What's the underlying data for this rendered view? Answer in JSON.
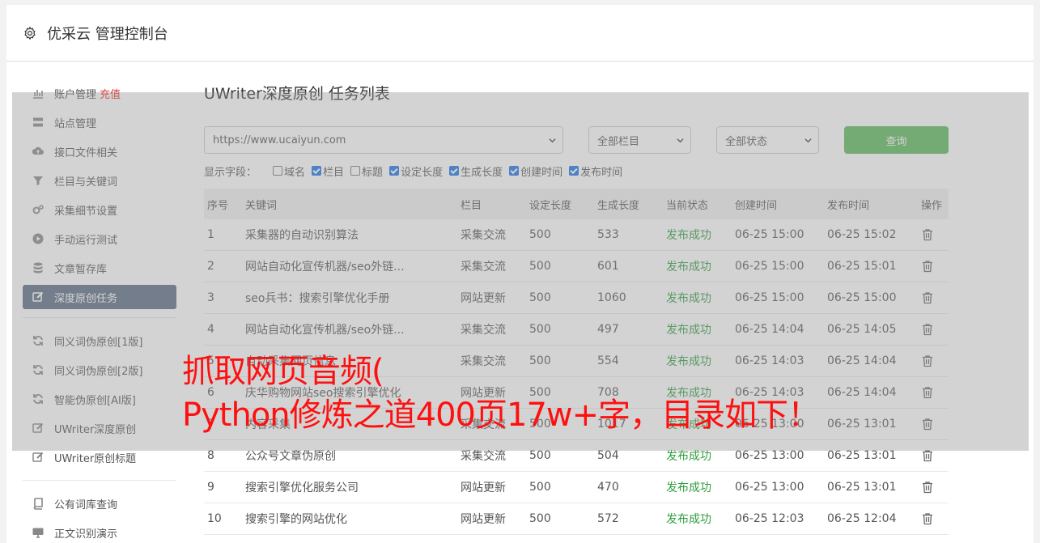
{
  "header": {
    "title": "优采云 管理控制台"
  },
  "sidebar": {
    "group1": [
      {
        "label": "账户管理",
        "extra": "充值",
        "icon": "bar-chart-icon"
      },
      {
        "label": "站点管理",
        "icon": "server-icon"
      },
      {
        "label": "接口文件相关",
        "icon": "cloud-upload-icon"
      },
      {
        "label": "栏目与关键词",
        "icon": "filter-icon"
      },
      {
        "label": "采集细节设置",
        "icon": "gears-icon"
      },
      {
        "label": "手动运行测试",
        "icon": "play-circle-icon"
      },
      {
        "label": "文章暂存库",
        "icon": "database-icon"
      },
      {
        "label": "深度原创任务",
        "icon": "edit-icon",
        "active": true
      }
    ],
    "group2": [
      {
        "label": "同义词伪原创[1版]",
        "icon": "refresh-icon"
      },
      {
        "label": "同义词伪原创[2版]",
        "icon": "refresh-icon"
      },
      {
        "label": "智能伪原创[AI版]",
        "icon": "refresh-icon"
      },
      {
        "label": "UWriter深度原创",
        "icon": "edit-icon"
      },
      {
        "label": "UWriter原创标题",
        "icon": "edit-icon"
      }
    ],
    "group3": [
      {
        "label": "公有词库查询",
        "icon": "book-icon"
      },
      {
        "label": "正文识别演示",
        "icon": "monitor-icon"
      }
    ]
  },
  "main": {
    "title": "UWriter深度原创 任务列表",
    "site_select": "https://www.ucaiyun.com",
    "column_select": "全部栏目",
    "status_select": "全部状态",
    "query_label": "查询",
    "fields_label": "显示字段：",
    "fields": [
      {
        "label": "域名",
        "checked": false
      },
      {
        "label": "栏目",
        "checked": true
      },
      {
        "label": "标题",
        "checked": false
      },
      {
        "label": "设定长度",
        "checked": true
      },
      {
        "label": "生成长度",
        "checked": true
      },
      {
        "label": "创建时间",
        "checked": true
      },
      {
        "label": "发布时间",
        "checked": true
      }
    ],
    "columns": [
      "序号",
      "关键词",
      "栏目",
      "设定长度",
      "生成长度",
      "当前状态",
      "创建时间",
      "发布时间",
      "操作"
    ],
    "rows": [
      [
        "1",
        "采集器的自动识别算法",
        "采集交流",
        "500",
        "533",
        "发布成功",
        "06-25 15:00",
        "06-25 15:02"
      ],
      [
        "2",
        "网站自动化宣传机器/seo外链...",
        "采集交流",
        "500",
        "601",
        "发布成功",
        "06-25 15:00",
        "06-25 15:01"
      ],
      [
        "3",
        "seo兵书：搜索引擎优化手册",
        "网站更新",
        "500",
        "1060",
        "发布成功",
        "06-25 15:00",
        "06-25 15:00"
      ],
      [
        "4",
        "网站自动化宣传机器/seo外链...",
        "采集交流",
        "500",
        "497",
        "发布成功",
        "06-25 14:04",
        "06-25 14:05"
      ],
      [
        "5",
        "自动采集网页信息",
        "采集交流",
        "500",
        "554",
        "发布成功",
        "06-25 14:03",
        "06-25 14:04"
      ],
      [
        "6",
        "庆华购物网站seo搜索引擎优化",
        "网站更新",
        "500",
        "708",
        "发布成功",
        "06-25 14:03",
        "06-25 14:04"
      ],
      [
        "7",
        "内容采集",
        "采集交流",
        "500",
        "1017",
        "发布成功",
        "06-25 13:00",
        "06-25 13:01"
      ],
      [
        "8",
        "公众号文章伪原创",
        "采集交流",
        "500",
        "504",
        "发布成功",
        "06-25 13:00",
        "06-25 13:01"
      ],
      [
        "9",
        "搜索引擎优化服务公司",
        "网站更新",
        "500",
        "470",
        "发布成功",
        "06-25 13:00",
        "06-25 13:01"
      ],
      [
        "10",
        "搜索引擎的网站优化",
        "网站更新",
        "500",
        "572",
        "发布成功",
        "06-25 12:03",
        "06-25 12:04"
      ]
    ]
  },
  "overlay": {
    "line1": "抓取网页音频(",
    "line2": "Python修炼之道400页17w+字，目录如下！"
  },
  "colors": {
    "active": "#5c6b84",
    "query": "#5cb85c",
    "success": "#2e9e3e",
    "recharge": "#e8322c",
    "overlay_text": "#ff1010"
  }
}
